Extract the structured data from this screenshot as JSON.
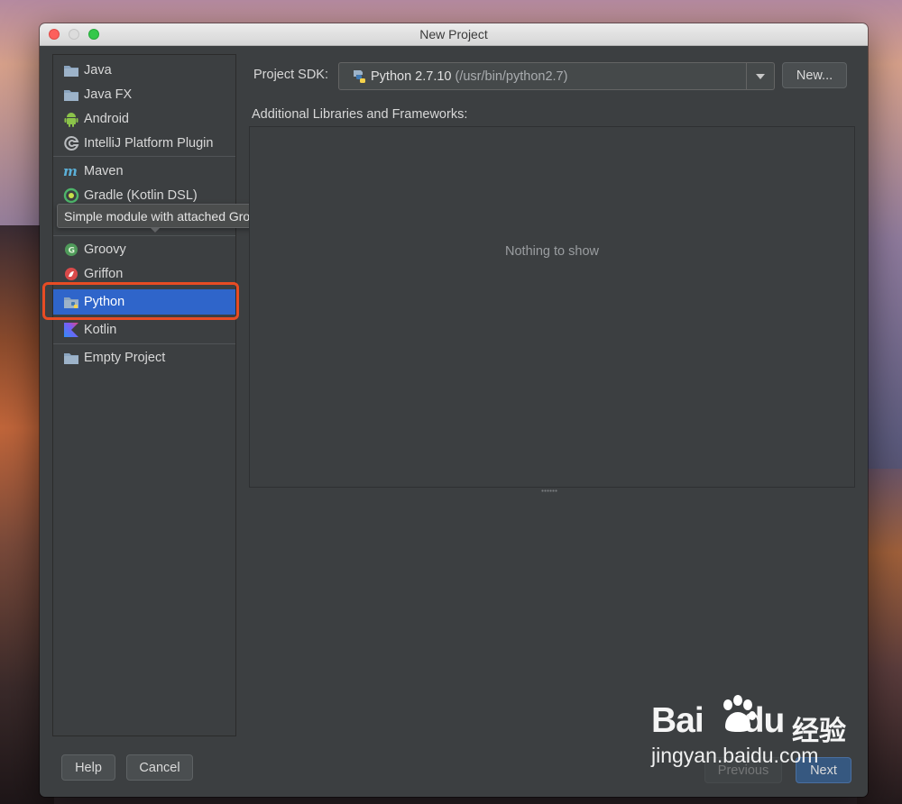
{
  "window": {
    "title": "New Project"
  },
  "left_list": {
    "items": [
      {
        "label": "Java",
        "icon": "folder-icon"
      },
      {
        "label": "Java FX",
        "icon": "folder-icon"
      },
      {
        "label": "Android",
        "icon": "android-icon"
      },
      {
        "label": "IntelliJ Platform Plugin",
        "icon": "plugin-icon"
      },
      {
        "label": "Maven",
        "icon": "maven-icon"
      },
      {
        "label": "Gradle (Kotlin DSL)",
        "icon": "gradle-icon"
      },
      {
        "label": "Groovy",
        "icon": "groovy-icon"
      },
      {
        "label": "Griffon",
        "icon": "griffon-icon"
      },
      {
        "label": "Python",
        "icon": "python-folder-icon",
        "selected": true
      },
      {
        "label": "Kotlin",
        "icon": "kotlin-icon"
      },
      {
        "label": "Empty Project",
        "icon": "folder-icon"
      }
    ]
  },
  "tooltip": {
    "text": "Simple module with attached Groovy library"
  },
  "sdk": {
    "label": "Project SDK:",
    "value": "Python 2.7.10",
    "path": "(/usr/bin/python2.7)",
    "new_button": "New..."
  },
  "libraries": {
    "label": "Additional Libraries and Frameworks:",
    "empty_text": "Nothing to show"
  },
  "footer": {
    "help": "Help",
    "cancel": "Cancel",
    "previous": "Previous",
    "next": "Next"
  },
  "watermark": {
    "brand": "Bai",
    "brand_tail": "du",
    "cn": "经验",
    "url": "jingyan.baidu.com"
  },
  "colors": {
    "selection": "#2f65ca",
    "highlight": "#e84c24",
    "panel": "#3c3f41"
  }
}
